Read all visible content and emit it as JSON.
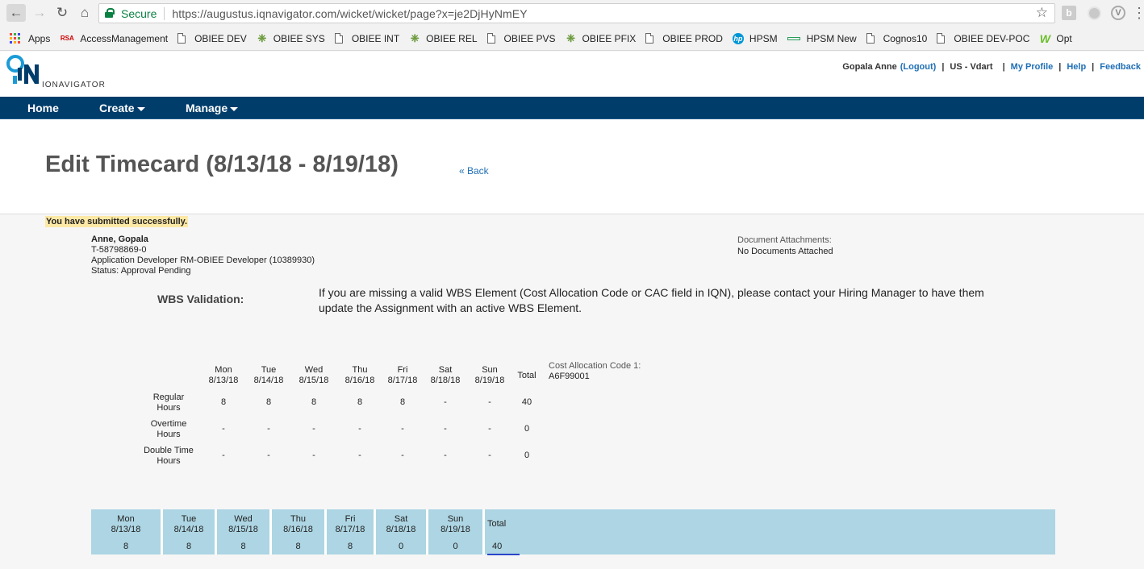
{
  "browser": {
    "secure_label": "Secure",
    "url": "https://augustus.iqnavigator.com/wicket/wicket/page?x=je2DjHyNmEY"
  },
  "bookmarks": [
    {
      "label": "Apps",
      "icon": "apps-grid-icon"
    },
    {
      "label": "AccessManagement",
      "icon": "rsa-icon"
    },
    {
      "label": "OBIEE DEV",
      "icon": "page-icon"
    },
    {
      "label": "OBIEE SYS",
      "icon": "tree-icon"
    },
    {
      "label": "OBIEE INT",
      "icon": "page-icon"
    },
    {
      "label": "OBIEE REL",
      "icon": "tree-icon"
    },
    {
      "label": "OBIEE PVS",
      "icon": "page-icon"
    },
    {
      "label": "OBIEE PFIX",
      "icon": "tree-icon"
    },
    {
      "label": "OBIEE PROD",
      "icon": "page-icon"
    },
    {
      "label": "HPSM",
      "icon": "hp-icon"
    },
    {
      "label": "HPSM New",
      "icon": "bar-icon"
    },
    {
      "label": "Cognos10",
      "icon": "page-icon"
    },
    {
      "label": "OBIEE DEV-POC",
      "icon": "page-icon"
    },
    {
      "label": "Opt",
      "icon": "w-icon"
    }
  ],
  "header": {
    "logo_text": "IONAVIGATOR",
    "user_name": "Gopala Anne",
    "logout": "(Logout)",
    "sep1": "|",
    "region": "US - Vdart",
    "sep2": "|",
    "profile": "My Profile",
    "sep3": "|",
    "help": "Help",
    "sep4": "|",
    "feedback": "Feedback"
  },
  "menu": {
    "home": "Home",
    "create": "Create",
    "manage": "Manage"
  },
  "page": {
    "title": "Edit Timecard (8/13/18 - 8/19/18)",
    "back": "« Back",
    "success_msg": "You have submitted successfully."
  },
  "person": {
    "name": "Anne, Gopala",
    "id": "T-58798869-0",
    "role": "Application Developer RM-OBIEE Developer (10389930)",
    "status": "Status: Approval Pending"
  },
  "attachments": {
    "label": "Document Attachments:",
    "value": "No Documents Attached"
  },
  "wbs": {
    "label": "WBS Validation:",
    "text": "If you are missing a valid WBS Element (Cost Allocation Code or CAC field in IQN), please contact your Hiring Manager to have them update the Assignment with an active WBS Element."
  },
  "cac": {
    "label": "Cost Allocation Code 1:",
    "value": "A6F99001"
  },
  "hours": {
    "days": [
      {
        "day": "Mon",
        "date": "8/13/18"
      },
      {
        "day": "Tue",
        "date": "8/14/18"
      },
      {
        "day": "Wed",
        "date": "8/15/18"
      },
      {
        "day": "Thu",
        "date": "8/16/18"
      },
      {
        "day": "Fri",
        "date": "8/17/18"
      },
      {
        "day": "Sat",
        "date": "8/18/18"
      },
      {
        "day": "Sun",
        "date": "8/19/18"
      }
    ],
    "total_label": "Total",
    "rows": [
      {
        "label1": "Regular",
        "label2": "Hours",
        "values": [
          "8",
          "8",
          "8",
          "8",
          "8",
          "-",
          "-"
        ],
        "total": "40"
      },
      {
        "label1": "Overtime",
        "label2": "Hours",
        "values": [
          "-",
          "-",
          "-",
          "-",
          "-",
          "-",
          "-"
        ],
        "total": "0"
      },
      {
        "label1": "Double Time",
        "label2": "Hours",
        "values": [
          "-",
          "-",
          "-",
          "-",
          "-",
          "-",
          "-"
        ],
        "total": "0"
      }
    ]
  },
  "summary": {
    "days": [
      {
        "day": "Mon",
        "date": "8/13/18",
        "value": "8"
      },
      {
        "day": "Tue",
        "date": "8/14/18",
        "value": "8"
      },
      {
        "day": "Wed",
        "date": "8/15/18",
        "value": "8"
      },
      {
        "day": "Thu",
        "date": "8/16/18",
        "value": "8"
      },
      {
        "day": "Fri",
        "date": "8/17/18",
        "value": "8"
      },
      {
        "day": "Sat",
        "date": "8/18/18",
        "value": "0"
      },
      {
        "day": "Sun",
        "date": "8/19/18",
        "value": "0"
      }
    ],
    "total_label": "Total",
    "total_value": "40"
  }
}
